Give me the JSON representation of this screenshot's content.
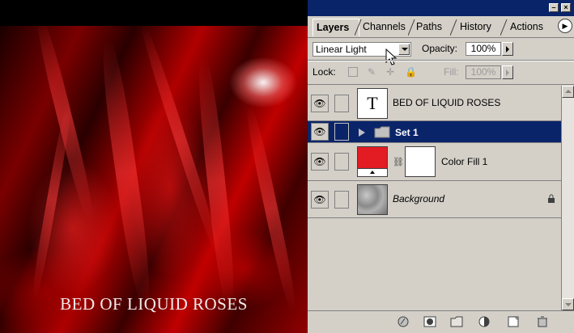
{
  "canvas": {
    "image_text": "BED OF LIQUID ROSES"
  },
  "panel": {
    "tabs": [
      {
        "label": "Layers",
        "active": true
      },
      {
        "label": "Channels",
        "active": false
      },
      {
        "label": "Paths",
        "active": false
      },
      {
        "label": "History",
        "active": false
      },
      {
        "label": "Actions",
        "active": false
      }
    ],
    "blend_mode": "Linear Light",
    "opacity_label": "Opacity:",
    "opacity_value": "100%",
    "lock_label": "Lock:",
    "fill_label": "Fill:",
    "fill_value": "100%",
    "layers": [
      {
        "name": "BED OF LIQUID ROSES",
        "kind": "text",
        "thumb_glyph": "T",
        "visible": true,
        "selected": false
      },
      {
        "name": "Set 1",
        "kind": "group",
        "visible": true,
        "selected": true
      },
      {
        "name": "Color Fill 1",
        "kind": "fill",
        "visible": true,
        "selected": false,
        "fill_color": "#e31b23"
      },
      {
        "name": "Background",
        "kind": "background",
        "visible": true,
        "selected": false,
        "locked": true
      }
    ]
  },
  "colors": {
    "title_bar": "#0a246a",
    "selected_row": "#0a246a",
    "panel_bg": "#d4d0c8",
    "fill_swatch": "#e31b23"
  },
  "icons": [
    "minimize-icon",
    "close-icon",
    "palette-menu-icon",
    "eye-icon",
    "chain-link-icon",
    "folder-icon",
    "lock-icon",
    "move-icon",
    "brush-icon",
    "layer-style-icon",
    "mask-icon",
    "new-set-icon",
    "adjustment-layer-icon",
    "new-layer-icon",
    "trash-icon"
  ]
}
